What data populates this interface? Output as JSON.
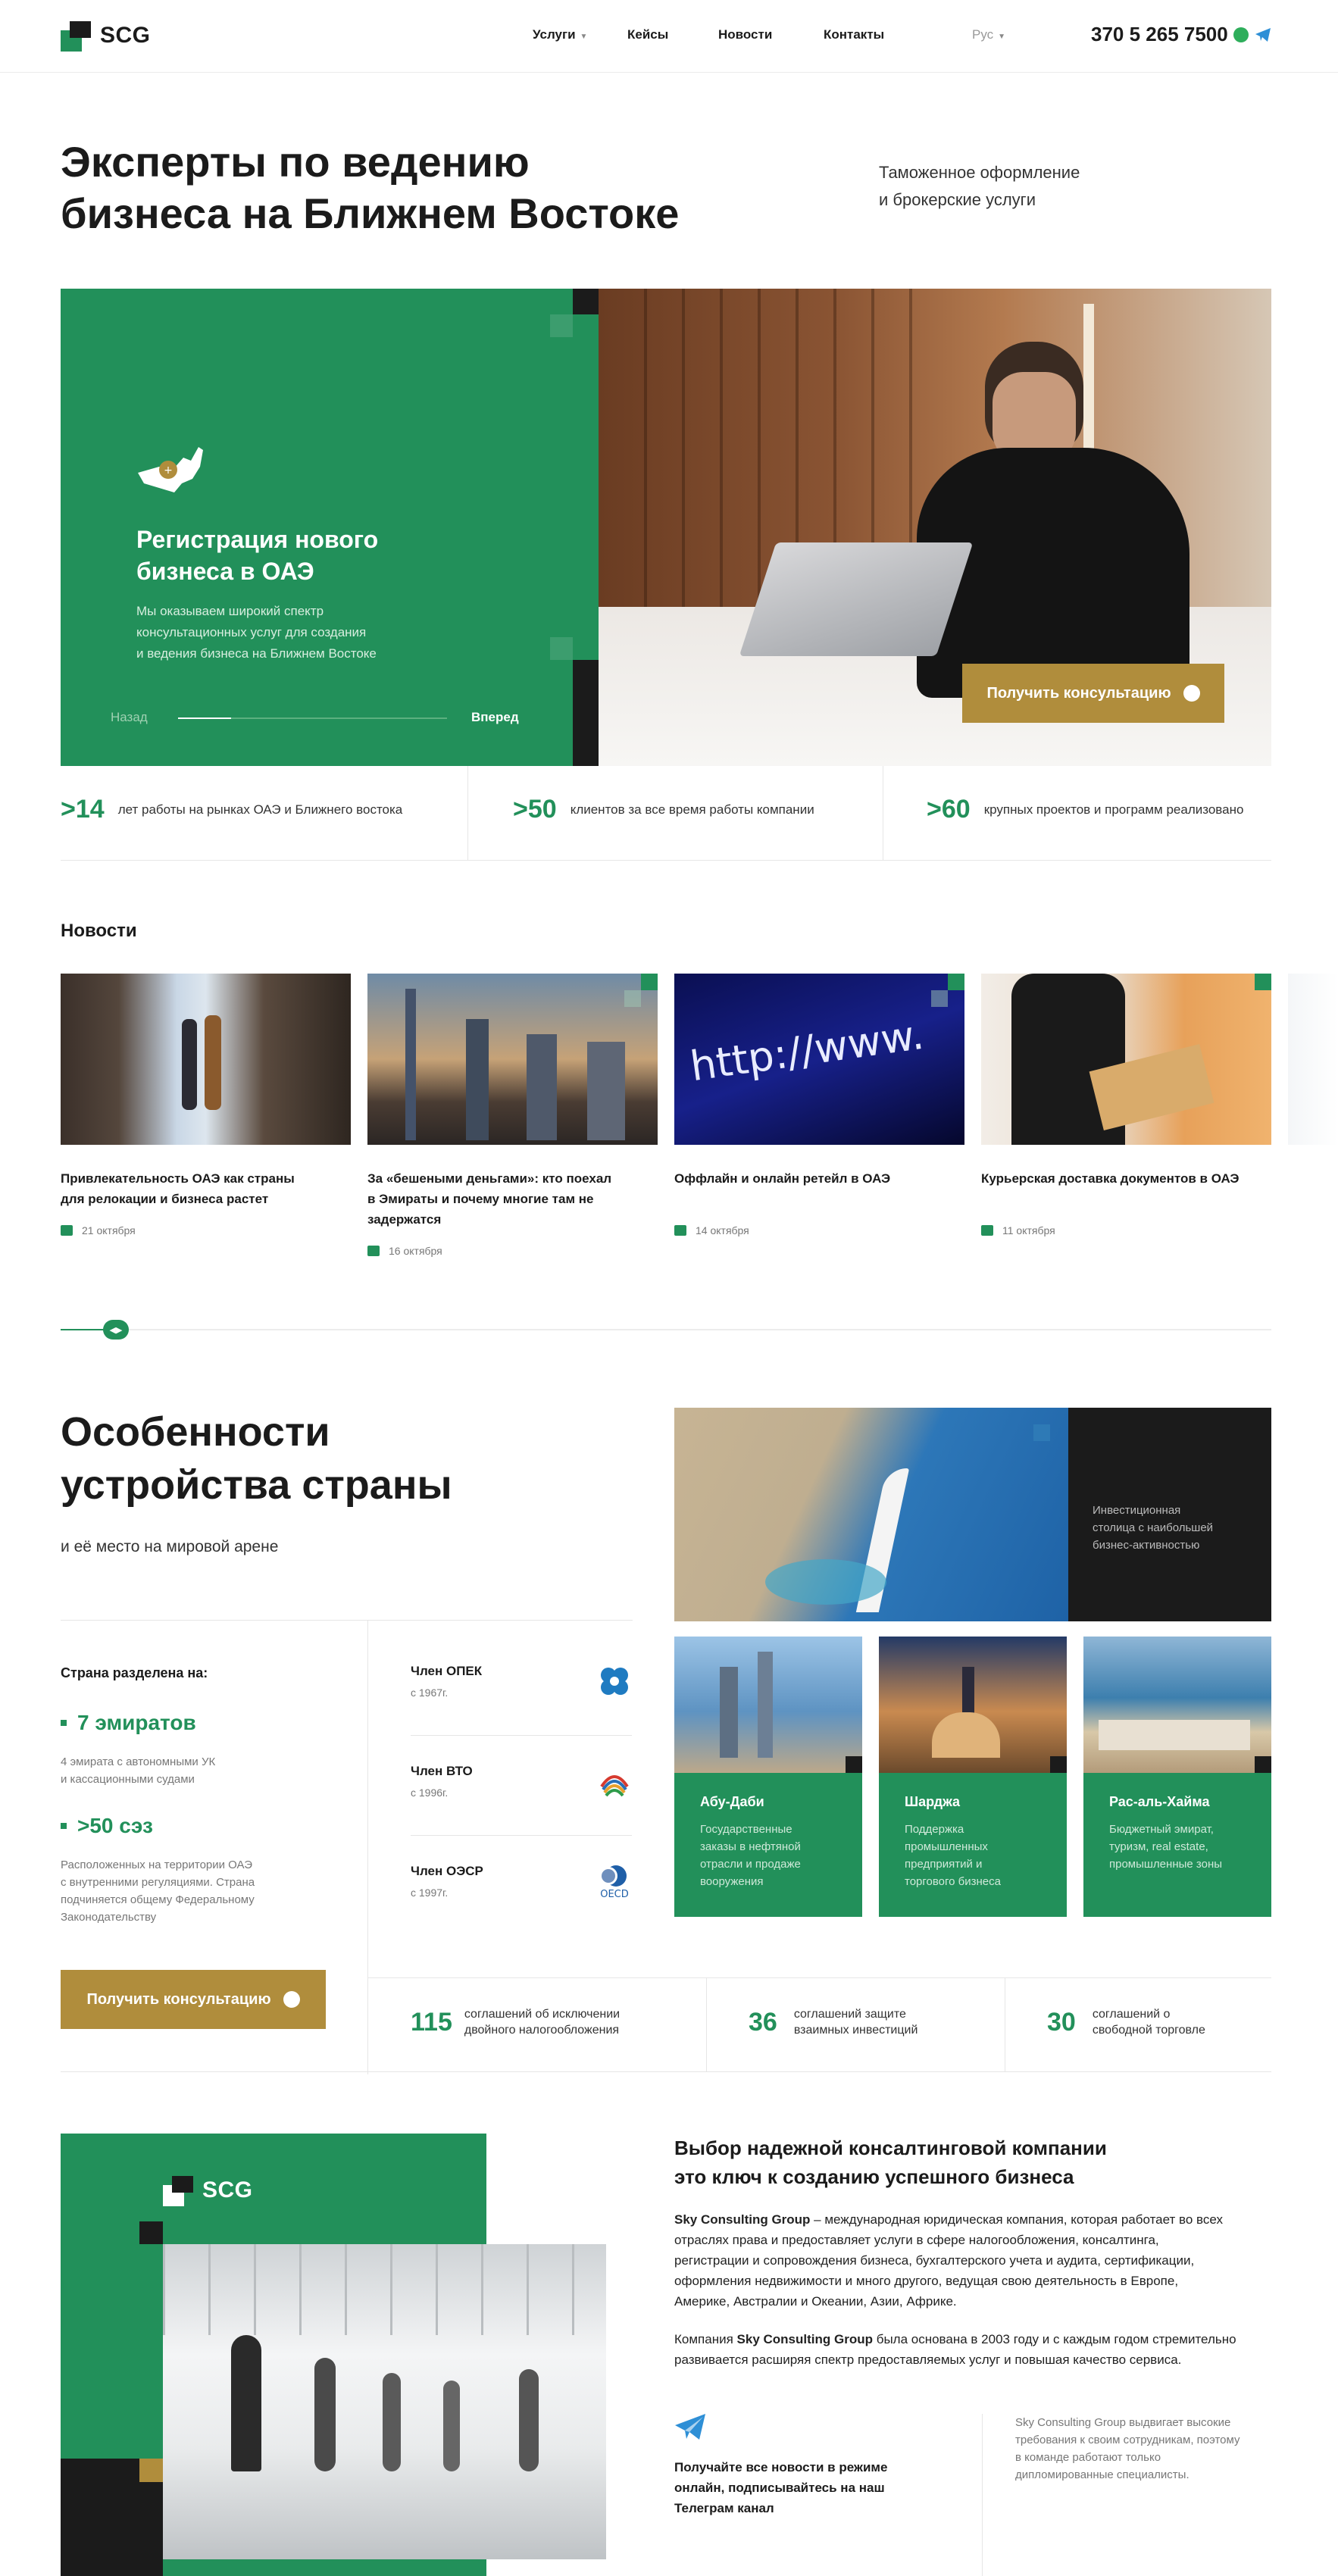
{
  "header": {
    "logo": "SCG",
    "nav": [
      {
        "label": "Услуги"
      },
      {
        "label": "Кейсы"
      },
      {
        "label": "Новости"
      },
      {
        "label": "Контакты"
      }
    ],
    "lang": "Рус",
    "phone": "370 5 265 7500"
  },
  "hero": {
    "title_line1": "Эксперты по ведению",
    "title_line2": "бизнеса на Ближнем Востоке",
    "sub_line1": "Таможенное оформление",
    "sub_line2": "и брокерские услуги",
    "slide_title_line1": "Регистрация нового",
    "slide_title_line2": "бизнеса в ОАЭ",
    "slide_text_line1": "Мы оказываем широкий спектр",
    "slide_text_line2": "консультационных услуг для создания",
    "slide_text_line3": "и ведения бизнеса на Ближнем Востоке",
    "prev": "Назад",
    "next": "Вперед",
    "counter": "1/5",
    "cta": "Получить консультацию"
  },
  "stats": [
    {
      "num": ">14",
      "text": "лет работы на рынках ОАЭ и Ближнего востока"
    },
    {
      "num": ">50",
      "text": "клиентов за все время работы компании"
    },
    {
      "num": ">60",
      "text": "крупных проектов и программ реализовано"
    }
  ],
  "news": {
    "heading": "Новости",
    "items": [
      {
        "title_l1": "Привлекательность ОАЭ как страны",
        "title_l2": "для релокации и бизнеса растет",
        "title_l3": "",
        "date": "21 октября"
      },
      {
        "title_l1": "За «бешеными деньгами»: кто поехал",
        "title_l2": "в Эмираты и почему многие там не",
        "title_l3": "задержатся",
        "date": "16 октября"
      },
      {
        "title_l1": "Оффлайн и онлайн ретейл в ОАЭ",
        "title_l2": "",
        "title_l3": "",
        "date": "14 октября"
      },
      {
        "title_l1": "Курьерская доставка документов в ОАЭ",
        "title_l2": "",
        "title_l3": "",
        "date": "11 октября"
      }
    ],
    "url_text": "http://www."
  },
  "features": {
    "title_l1": "Особенности",
    "title_l2": "устройства страны",
    "subtitle": "и её место на мировой арене",
    "divided_label": "Страна разделена на:",
    "emirates": "7 эмиратов",
    "emirates_desc_l1": "4 эмирата с автономными УК",
    "emirates_desc_l2": "и кассационными судами",
    "sez": ">50 сэз",
    "sez_desc_l1": "Расположенных на территории ОАЭ",
    "sez_desc_l2": "с внутренними регуляциями. Страна",
    "sez_desc_l3": "подчиняется общему Федеральному",
    "sez_desc_l4": "Законодательству",
    "cta": "Получить консультацию",
    "orgs": [
      {
        "title": "Член ОПЕК",
        "year": "с 1967г."
      },
      {
        "title": "Член ВТО",
        "year": "с 1996г."
      },
      {
        "title": "Член ОЭСР",
        "year": "с 1997г.",
        "logo": "OECD"
      }
    ],
    "dubai_caption_l1": "Инвестиционная",
    "dubai_caption_l2": "столица с наибольшей",
    "dubai_caption_l3": "бизнес-активностью",
    "cards": [
      {
        "title": "Абу-Даби",
        "d1": "Государственные",
        "d2": "заказы в нефтяной",
        "d3": "отрасли и продаже",
        "d4": "вооружения"
      },
      {
        "title": "Шарджа",
        "d1": "Поддержка",
        "d2": "промышленных",
        "d3": "предприятий и",
        "d4": "торгового бизнеса"
      },
      {
        "title": "Рас-аль-Хайма",
        "d1": "Бюджетный эмират,",
        "d2": "туризм, real estate,",
        "d3": "промышленные зоны",
        "d4": ""
      }
    ],
    "agreements": [
      {
        "num": "115",
        "t1": "соглашений об исключении",
        "t2": "двойного налогообложения"
      },
      {
        "num": "36",
        "t1": "соглашений защите",
        "t2": "взаимных инвестиций"
      },
      {
        "num": "30",
        "t1": "соглашений о",
        "t2": "свободной торговле"
      }
    ]
  },
  "about": {
    "logo": "SCG",
    "title_l1": "Выбор надежной консалтинговой компании",
    "title_l2": "это ключ к созданию успешного бизнеса",
    "p1_bold": "Sky Consulting Group",
    "p1_l1": " – международная юридическая компания, которая работает во всех",
    "p1_l2": "отраслях права и предоставляет услуги в сфере налогообложения, консалтинга,",
    "p1_l3": "регистрации и сопровождения бизнеса, бухгалтерского учета и аудита, сертификации,",
    "p1_l4": "оформления недвижимости и много другого, ведущая свою деятельность в Европе,",
    "p1_l5": "Америке, Австралии и Океании, Азии, Африке.",
    "p2_a": "Компания ",
    "p2_bold": "Sky Consulting Group",
    "p2_b": " была основана в 2003 году и с каждым годом стремительно",
    "p2_l2": "развивается расширяя спектр предоставляемых услуг и повышая качество сервиса.",
    "tg_l1": "Получайте все новости в режиме",
    "tg_l2": "онлайн, подписывайтесь на наш",
    "tg_l3": "Телеграм канал",
    "req_l1": "Sky Consulting Group выдвигает высокие",
    "req_l2": "требования к своим сотрудникам, поэтому",
    "req_l3": "в команде работают только",
    "req_l4": "дипломированные специалисты."
  }
}
